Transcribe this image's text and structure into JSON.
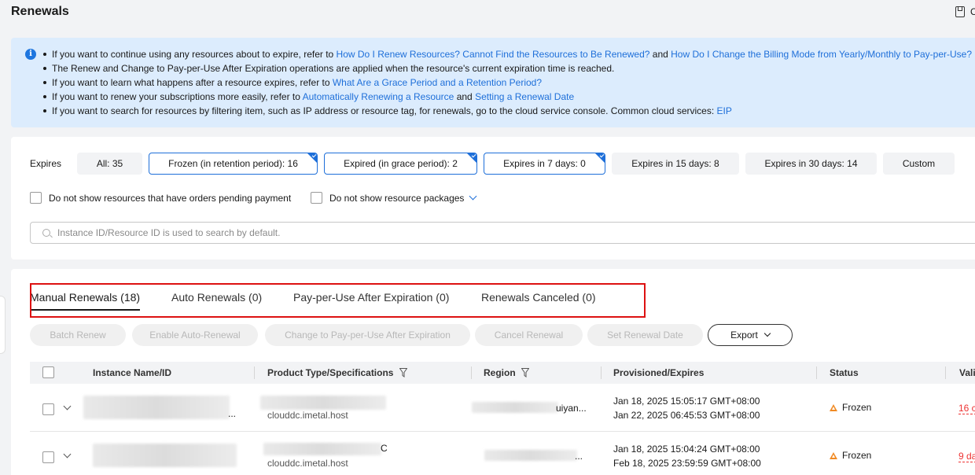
{
  "page": {
    "title": "Renewals",
    "corner_text": "C"
  },
  "notice": {
    "items": [
      {
        "parts": [
          {
            "t": "If you want to continue using any resources about to expire, refer to "
          },
          {
            "t": "How Do I Renew Resources? Cannot Find the Resources to Be Renewed?",
            "link": true
          },
          {
            "t": " and "
          },
          {
            "t": "How Do I Change the Billing Mode from Yearly/Monthly to Pay-per-Use?",
            "link": true
          }
        ]
      },
      {
        "parts": [
          {
            "t": "The Renew and Change to Pay-per-Use After Expiration operations are applied when the resource's current expiration time is reached."
          }
        ]
      },
      {
        "parts": [
          {
            "t": "If you want to learn what happens after a resource expires, refer to "
          },
          {
            "t": "What Are a Grace Period and a Retention Period?",
            "link": true
          }
        ]
      },
      {
        "parts": [
          {
            "t": "If you want to renew your subscriptions more easily, refer to "
          },
          {
            "t": "Automatically Renewing a Resource",
            "link": true
          },
          {
            "t": " and "
          },
          {
            "t": "Setting a Renewal Date",
            "link": true
          }
        ]
      },
      {
        "parts": [
          {
            "t": "If you want to search for resources by filtering item, such as IP address or resource tag, for renewals, go to the cloud service console. Common cloud services: "
          },
          {
            "t": "EIP",
            "link": true
          }
        ]
      }
    ]
  },
  "filters": {
    "label": "Expires",
    "chips": {
      "all": "All: 35",
      "frozen": "Frozen (in retention period): 16",
      "expired": "Expired (in grace period): 2",
      "d7": "Expires in 7 days: 0",
      "d15": "Expires in 15 days: 8",
      "d30": "Expires in 30 days: 14",
      "custom": "Custom"
    },
    "checkbox_pending": "Do not show resources that have orders pending payment",
    "checkbox_packages": "Do not show resource packages",
    "search_placeholder": "Instance ID/Resource ID is used to search by default."
  },
  "tabs": {
    "manual": "Manual Renewals (18)",
    "auto": "Auto Renewals (0)",
    "payg": "Pay-per-Use After Expiration (0)",
    "canceled": "Renewals Canceled (0)"
  },
  "actions": {
    "batch_renew": "Batch Renew",
    "enable_auto": "Enable Auto-Renewal",
    "change_payg": "Change to Pay-per-Use After Expiration",
    "cancel_renewal": "Cancel Renewal",
    "set_date": "Set Renewal Date",
    "export": "Export"
  },
  "table": {
    "headers": {
      "name": "Instance Name/ID",
      "product": "Product Type/Specifications",
      "region": "Region",
      "provisioned": "Provisioned/Expires",
      "status": "Status",
      "validity": "Vali"
    },
    "rows": [
      {
        "name_suffix": "...",
        "product_suffix": "",
        "spec": "clouddc.imetal.host",
        "region": "uiyan...",
        "provisioned": "Jan 18, 2025 15:05:17 GMT+08:00",
        "expires": "Jan 22, 2025 06:45:53 GMT+08:00",
        "status": "Frozen",
        "validity": "16 c"
      },
      {
        "name_suffix": "",
        "product_suffix": "C",
        "spec": "clouddc.imetal.host",
        "region": "...",
        "provisioned": "Jan 18, 2025 15:04:24 GMT+08:00",
        "expires": "Feb 18, 2025 23:59:59 GMT+08:00",
        "status": "Frozen",
        "validity": "9 da"
      }
    ]
  },
  "colors": {
    "link": "#1e6fd9",
    "notice_bg": "#dcecfd",
    "highlight": "#dd1111",
    "warn": "#f08a24"
  }
}
